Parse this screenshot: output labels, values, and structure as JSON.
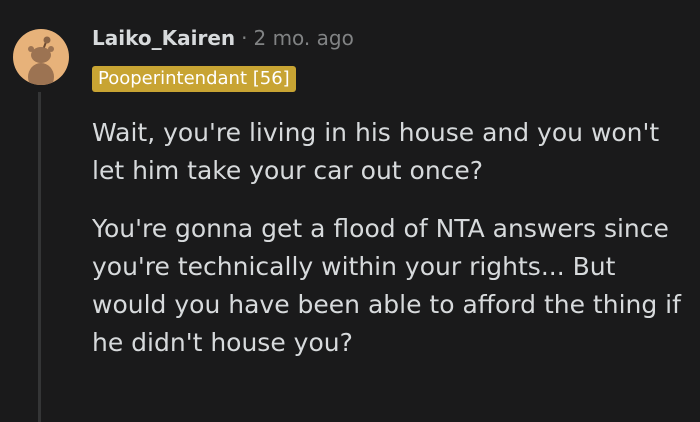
{
  "comment": {
    "author": "Laiko_Kairen",
    "separator": "·",
    "age": "2 mo. ago",
    "flair": "Pooperintendant [56]",
    "paragraphs": [
      "Wait, you're living in his house and you won't let him take your car out once?",
      "You're gonna get a flood of NTA answers since you're technically within your rights... But would you have been able to afford the thing if he didn't house you?"
    ]
  },
  "colors": {
    "background": "#1a1a1b",
    "text": "#d7dadc",
    "meta": "#818384",
    "flair": "#c8a433",
    "avatar": "#e7b27a"
  },
  "icons": [
    "snoo-avatar-icon"
  ]
}
